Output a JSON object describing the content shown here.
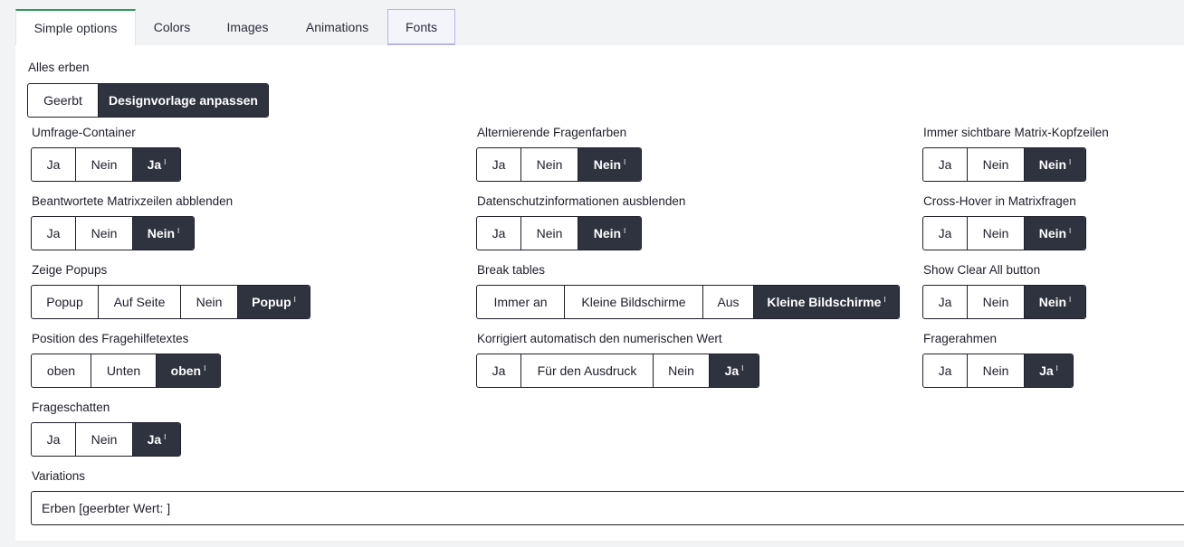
{
  "tabs": [
    "Simple options",
    "Colors",
    "Images",
    "Animations",
    "Fonts"
  ],
  "inherit_all": {
    "label": "Alles erben",
    "options": [
      "Geerbt",
      "Designvorlage anpassen"
    ]
  },
  "fields": {
    "container": {
      "label": "Umfrage-Container",
      "options": [
        "Ja",
        "Nein",
        "Ja"
      ]
    },
    "alt_colors": {
      "label": "Alternierende Fragenfarben",
      "options": [
        "Ja",
        "Nein",
        "Nein"
      ]
    },
    "matrix_header": {
      "label": "Immer sichtbare Matrix-Kopfzeilen",
      "options": [
        "Ja",
        "Nein",
        "Nein"
      ]
    },
    "hide_answered": {
      "label": "Beantwortete Matrixzeilen abblenden",
      "options": [
        "Ja",
        "Nein",
        "Nein"
      ]
    },
    "privacy": {
      "label": "Datenschutzinformationen ausblenden",
      "options": [
        "Ja",
        "Nein",
        "Nein"
      ]
    },
    "cross_hover": {
      "label": "Cross-Hover in Matrixfragen",
      "options": [
        "Ja",
        "Nein",
        "Nein"
      ]
    },
    "popups": {
      "label": "Zeige Popups",
      "options": [
        "Popup",
        "Auf Seite",
        "Nein",
        "Popup"
      ]
    },
    "break_tables": {
      "label": "Break tables",
      "options": [
        "Immer an",
        "Kleine Bildschirme",
        "Aus",
        "Kleine Bildschirme"
      ]
    },
    "clear_all": {
      "label": "Show Clear All button",
      "options": [
        "Ja",
        "Nein",
        "Nein"
      ]
    },
    "help_pos": {
      "label": "Position des Fragehilfetextes",
      "options": [
        "oben",
        "Unten",
        "oben"
      ]
    },
    "auto_correct": {
      "label": "Korrigiert automatisch den numerischen Wert",
      "options": [
        "Ja",
        "Für den Ausdruck",
        "Nein",
        "Ja"
      ]
    },
    "frame": {
      "label": "Fragerahmen",
      "options": [
        "Ja",
        "Nein",
        "Ja"
      ]
    },
    "shadow": {
      "label": "Frageschatten",
      "options": [
        "Ja",
        "Nein",
        "Ja"
      ]
    }
  },
  "inherited_marker": "I",
  "variations": {
    "label": "Variations",
    "value": "Erben [geerbter Wert: ]"
  }
}
